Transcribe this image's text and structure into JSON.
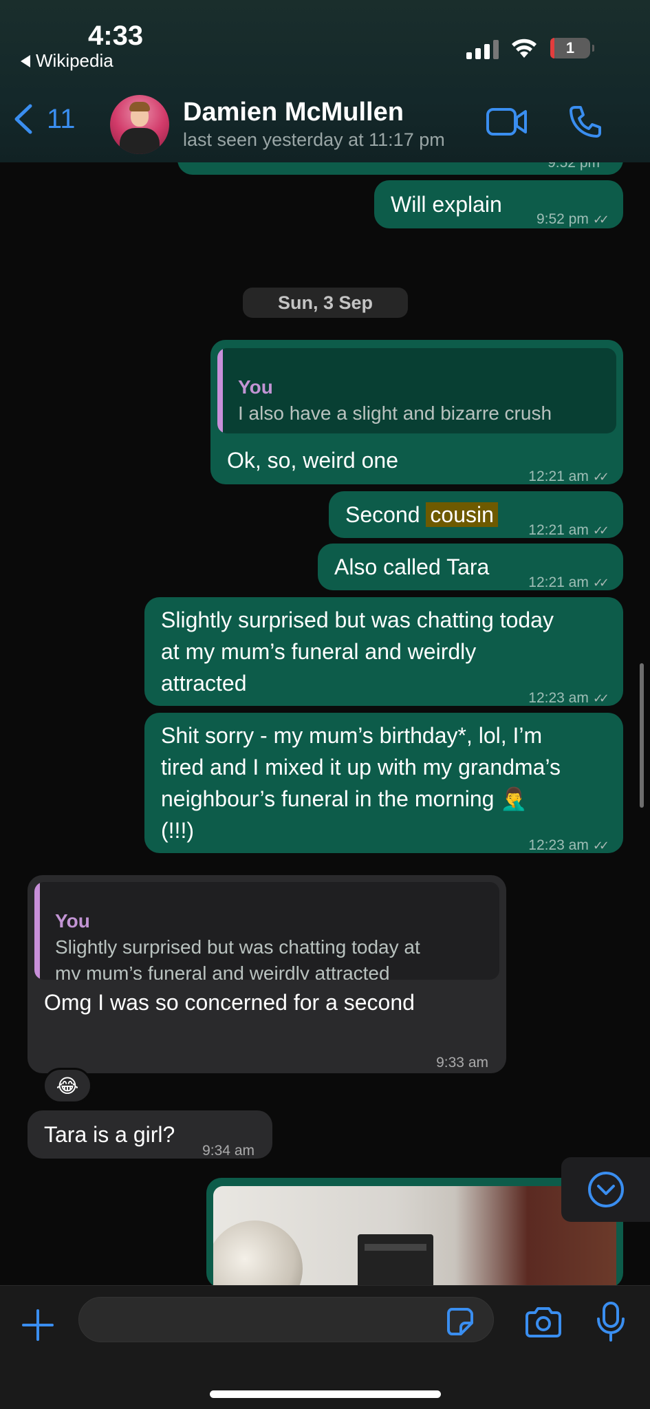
{
  "status_bar": {
    "time": "4:33",
    "back_app": "Wikipedia",
    "battery": "1"
  },
  "header": {
    "back_count": "11",
    "contact_name": "Damien McMullen",
    "last_seen": "last seen yesterday at 11:17 pm"
  },
  "messages": {
    "prev_time": "9:52 pm",
    "will_explain": {
      "text": "Will explain",
      "time": "9:52 pm"
    },
    "date_separator": "Sun, 3 Sep",
    "weird_one": {
      "quote_author": "You",
      "quote_text": "I also have a slight and bizarre crush",
      "text": "Ok, so, weird one",
      "time": "12:21 am"
    },
    "second_cousin": {
      "text_a": "Second",
      "text_b": "cousin",
      "time": "12:21 am"
    },
    "also_tara": {
      "text": "Also called Tara",
      "time": "12:21 am"
    },
    "surprised": {
      "line1": "Slightly surprised but was chatting today",
      "line2": "at my mum’s funeral and weirdly",
      "line3": "attracted",
      "time": "12:23 am"
    },
    "shit_sorry": {
      "line1": "Shit sorry - my mum’s birthday*, lol, I’m",
      "line2": "tired and I mixed it up with my grandma’s",
      "line3": "neighbour’s funeral in the morning 🤦‍♂️",
      "line4": "(!!!)",
      "time": "12:23 am"
    },
    "omg": {
      "quote_author": "You",
      "quote_line1": "Slightly surprised but was chatting today at",
      "quote_line2": "my mum’s funeral and weirdly attracted",
      "text": "Omg  I was so concerned for a second",
      "time": "9:33 am",
      "reaction": "😂"
    },
    "tara_girl": {
      "text": "Tara is a girl?",
      "time": "9:34 am"
    }
  },
  "icons": {
    "back": "chevron-left-icon",
    "video": "video-camera-icon",
    "call": "phone-icon",
    "scroll_down": "chevron-down-circle-icon",
    "plus": "plus-icon",
    "sticker": "sticker-icon",
    "camera": "camera-icon",
    "mic": "microphone-icon"
  },
  "colors": {
    "accent": "#3a8ef0",
    "outgoing_bubble": "#0d5c4a",
    "incoming_bubble": "#2a2a2c",
    "quote_bar": "#c88fd9"
  }
}
